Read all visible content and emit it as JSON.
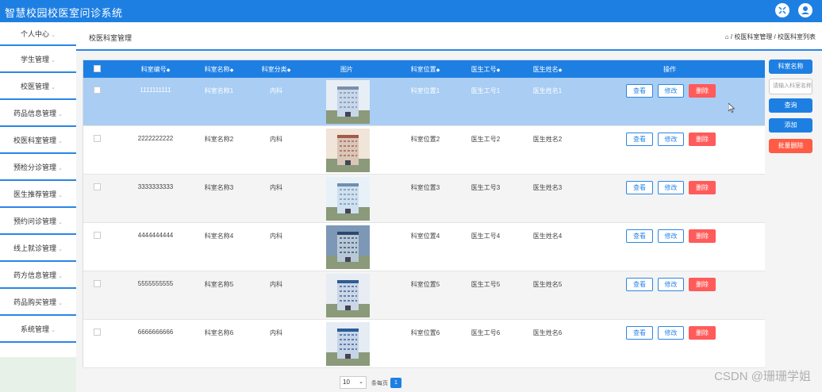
{
  "app": {
    "title": "智慧校园校医室问诊系统"
  },
  "sidebar": {
    "items": [
      {
        "label": "个人中心",
        "arrow": "⌄"
      },
      {
        "label": "学生管理",
        "arrow": "⌄"
      },
      {
        "label": "校医管理",
        "arrow": "⌄"
      },
      {
        "label": "药品信息管理",
        "arrow": "⌄"
      },
      {
        "label": "校医科室管理",
        "arrow": "⌄"
      },
      {
        "label": "预检分诊管理",
        "arrow": "⌄"
      },
      {
        "label": "医生推荐管理",
        "arrow": "⌄"
      },
      {
        "label": "预约问诊管理",
        "arrow": "⌄"
      },
      {
        "label": "线上就诊管理",
        "arrow": "⌄"
      },
      {
        "label": "药方信息管理",
        "arrow": "⌄"
      },
      {
        "label": "药品购买管理",
        "arrow": "⌄"
      },
      {
        "label": "系统管理",
        "arrow": "⌄"
      }
    ]
  },
  "header": {
    "page_title": "校医科室管理",
    "breadcrumb": "/ 校医科室管理 / 校医科室列表"
  },
  "table": {
    "columns": [
      "科室编号",
      "科室名称",
      "科室分类",
      "图片",
      "科室位置",
      "医生工号",
      "医生姓名",
      "操作"
    ],
    "sort_glyph": "◆",
    "rows": [
      {
        "code": "1111111111",
        "name": "科室名称1",
        "category": "内科",
        "location": "科室位置1",
        "doc_id": "医生工号1",
        "doc_name": "医生姓名1"
      },
      {
        "code": "2222222222",
        "name": "科室名称2",
        "category": "内科",
        "location": "科室位置2",
        "doc_id": "医生工号2",
        "doc_name": "医生姓名2"
      },
      {
        "code": "3333333333",
        "name": "科室名称3",
        "category": "内科",
        "location": "科室位置3",
        "doc_id": "医生工号3",
        "doc_name": "医生姓名3"
      },
      {
        "code": "4444444444",
        "name": "科室名称4",
        "category": "内科",
        "location": "科室位置4",
        "doc_id": "医生工号4",
        "doc_name": "医生姓名4"
      },
      {
        "code": "5555555555",
        "name": "科室名称5",
        "category": "内科",
        "location": "科室位置5",
        "doc_id": "医生工号5",
        "doc_name": "医生姓名5"
      },
      {
        "code": "6666666666",
        "name": "科室名称6",
        "category": "内科",
        "location": "科室位置6",
        "doc_id": "医生工号6",
        "doc_name": "医生姓名6"
      }
    ],
    "actions": {
      "view": "查看",
      "edit": "修改",
      "delete": "删除"
    }
  },
  "right_panel": {
    "filter_label": "科室名称",
    "search_placeholder": "请输入科室名称",
    "query": "查询",
    "add": "添加",
    "batch_delete": "批量删除"
  },
  "pagination": {
    "page_size": "10",
    "per_page_label": "条每页",
    "current_page": "1"
  },
  "watermark": "CSDN @珊珊学姐",
  "colors": {
    "primary": "#1e7fe3",
    "danger": "#ff5b5b",
    "selected_row": "#a9cdf3"
  }
}
